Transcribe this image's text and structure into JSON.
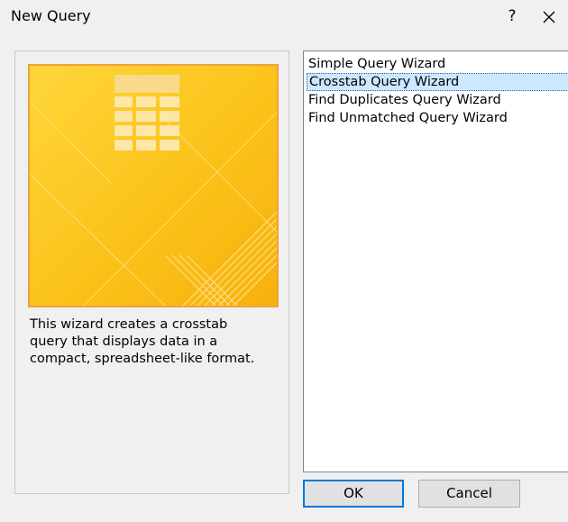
{
  "dialog": {
    "title": "New Query",
    "help_label": "?",
    "close_icon": "close-icon"
  },
  "preview": {
    "icon": "datasheet-grid-icon",
    "colors": {
      "background": "#fbc21a",
      "border": "#f0a23c",
      "grid": "#f9d98a"
    }
  },
  "description": "This wizard creates a crosstab query that displays data in a compact, spreadsheet-like format.",
  "wizards": {
    "items": [
      {
        "label": "Simple Query Wizard",
        "selected": false
      },
      {
        "label": "Crosstab Query Wizard",
        "selected": true
      },
      {
        "label": "Find Duplicates Query Wizard",
        "selected": false
      },
      {
        "label": "Find Unmatched Query Wizard",
        "selected": false
      }
    ]
  },
  "buttons": {
    "ok_label": "OK",
    "cancel_label": "Cancel"
  }
}
